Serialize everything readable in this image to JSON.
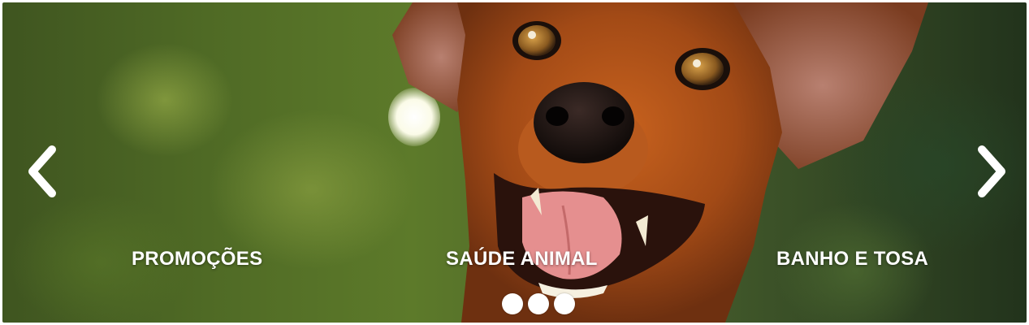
{
  "banner": {
    "image": "dog-portrait",
    "prev_icon": "chevron-left-icon",
    "next_icon": "chevron-right-icon",
    "categories": [
      {
        "label": "PROMOÇÕES"
      },
      {
        "label": "SAÚDE ANIMAL"
      },
      {
        "label": "BANHO E TOSA"
      }
    ],
    "slide_count": 3,
    "colors": {
      "text": "#ffffff",
      "dot": "#ffffff"
    }
  }
}
